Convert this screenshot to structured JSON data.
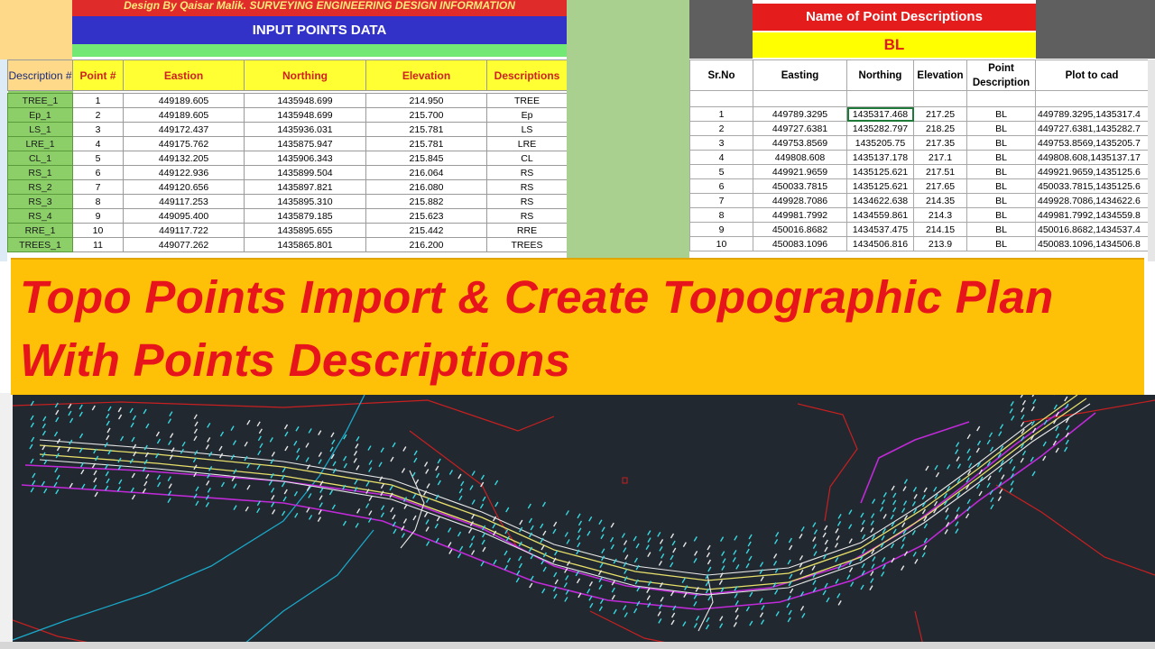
{
  "left_sheet": {
    "designer_line": "Design By Qaisar Malik.  SURVEYING ENGINEERING DESIGN INFORMATION",
    "title": "INPUT POINTS DATA",
    "headers": [
      "Description #",
      "Point #",
      "Eastion",
      "Northing",
      "Elevation",
      "Descriptions"
    ],
    "rows": [
      {
        "desc_code": "TREE_1",
        "point": "1",
        "easting": "449189.605",
        "northing": "1435948.699",
        "elevation": "214.950",
        "description": "TREE"
      },
      {
        "desc_code": "Ep_1",
        "point": "2",
        "easting": "449189.605",
        "northing": "1435948.699",
        "elevation": "215.700",
        "description": "Ep"
      },
      {
        "desc_code": "LS_1",
        "point": "3",
        "easting": "449172.437",
        "northing": "1435936.031",
        "elevation": "215.781",
        "description": "LS"
      },
      {
        "desc_code": "LRE_1",
        "point": "4",
        "easting": "449175.762",
        "northing": "1435875.947",
        "elevation": "215.781",
        "description": "LRE"
      },
      {
        "desc_code": "CL_1",
        "point": "5",
        "easting": "449132.205",
        "northing": "1435906.343",
        "elevation": "215.845",
        "description": "CL"
      },
      {
        "desc_code": "RS_1",
        "point": "6",
        "easting": "449122.936",
        "northing": "1435899.504",
        "elevation": "216.064",
        "description": "RS"
      },
      {
        "desc_code": "RS_2",
        "point": "7",
        "easting": "449120.656",
        "northing": "1435897.821",
        "elevation": "216.080",
        "description": "RS"
      },
      {
        "desc_code": "RS_3",
        "point": "8",
        "easting": "449117.253",
        "northing": "1435895.310",
        "elevation": "215.882",
        "description": "RS"
      },
      {
        "desc_code": "RS_4",
        "point": "9",
        "easting": "449095.400",
        "northing": "1435879.185",
        "elevation": "215.623",
        "description": "RS"
      },
      {
        "desc_code": "RRE_1",
        "point": "10",
        "easting": "449117.722",
        "northing": "1435895.655",
        "elevation": "215.442",
        "description": "RRE"
      },
      {
        "desc_code": "TREES_1",
        "point": "11",
        "easting": "449077.262",
        "northing": "1435865.801",
        "elevation": "216.200",
        "description": "TREES"
      }
    ]
  },
  "right_sheet": {
    "title": "Name of Point Descriptions",
    "selected_description": "BL",
    "headers": [
      "Sr.No",
      "Easting",
      "Northing",
      "Elevation",
      "Point Description",
      "Plot to cad"
    ],
    "rows": [
      {
        "sr": "1",
        "easting": "449789.3295",
        "northing": "1435317.468",
        "elevation": "217.25",
        "desc": "BL",
        "plot": "449789.3295,1435317.4"
      },
      {
        "sr": "2",
        "easting": "449727.6381",
        "northing": "1435282.797",
        "elevation": "218.25",
        "desc": "BL",
        "plot": "449727.6381,1435282.7"
      },
      {
        "sr": "3",
        "easting": "449753.8569",
        "northing": "1435205.75",
        "elevation": "217.35",
        "desc": "BL",
        "plot": "449753.8569,1435205.7"
      },
      {
        "sr": "4",
        "easting": "449808.608",
        "northing": "1435137.178",
        "elevation": "217.1",
        "desc": "BL",
        "plot": "449808.608,1435137.17"
      },
      {
        "sr": "5",
        "easting": "449921.9659",
        "northing": "1435125.621",
        "elevation": "217.51",
        "desc": "BL",
        "plot": "449921.9659,1435125.6"
      },
      {
        "sr": "6",
        "easting": "450033.7815",
        "northing": "1435125.621",
        "elevation": "217.65",
        "desc": "BL",
        "plot": "450033.7815,1435125.6"
      },
      {
        "sr": "7",
        "easting": "449928.7086",
        "northing": "1434622.638",
        "elevation": "214.35",
        "desc": "BL",
        "plot": "449928.7086,1434622.6"
      },
      {
        "sr": "8",
        "easting": "449981.7992",
        "northing": "1434559.861",
        "elevation": "214.3",
        "desc": "BL",
        "plot": "449981.7992,1434559.8"
      },
      {
        "sr": "9",
        "easting": "450016.8682",
        "northing": "1434537.475",
        "elevation": "214.15",
        "desc": "BL",
        "plot": "450016.8682,1434537.4"
      },
      {
        "sr": "10",
        "easting": "450083.1096",
        "northing": "1434506.816",
        "elevation": "213.9",
        "desc": "BL",
        "plot": "450083.1096,1434506.8"
      }
    ]
  },
  "banner": {
    "line1": "Topo Points Import & Create Topographic Plan",
    "line2": "With Points Descriptions"
  },
  "colors": {
    "banner_bg": "#ffc107",
    "banner_text": "#e8141b",
    "cad_bg": "#212830",
    "road_magenta": "#c02ad8",
    "road_yellow": "#e8e06a",
    "road_white": "#e8e8e8",
    "points_cyan": "#38d8e0",
    "boundary_red": "#c82020",
    "river_cyan": "#1aa8c8"
  }
}
